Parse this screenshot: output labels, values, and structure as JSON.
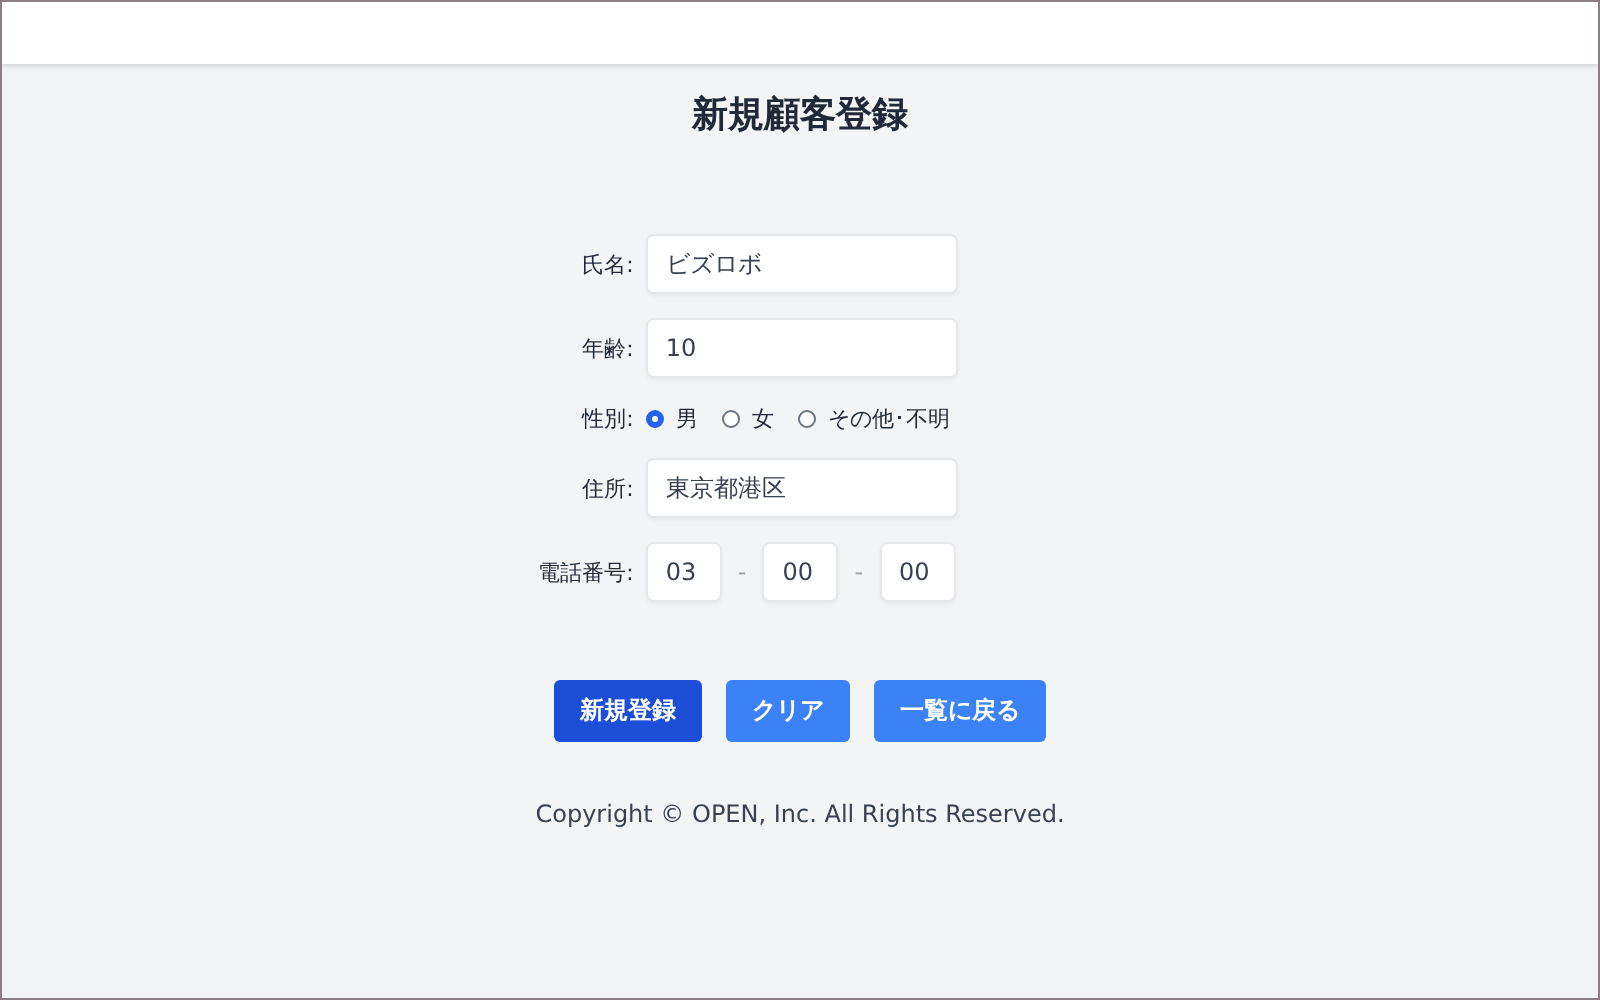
{
  "title": "新規顧客登録",
  "fields": [
    {
      "kind": "text",
      "label": "氏名:",
      "value": "ビズロボ"
    },
    {
      "kind": "text",
      "label": "年齢:",
      "value": "10"
    },
    {
      "kind": "radio",
      "label": "性別:",
      "options": [
        {
          "label": "男",
          "selected": true
        },
        {
          "label": "女",
          "selected": false
        },
        {
          "label": "その他･不明",
          "selected": false
        }
      ]
    },
    {
      "kind": "text",
      "label": "住所:",
      "value": "東京都港区"
    },
    {
      "kind": "phone",
      "label": "電話番号:",
      "parts": [
        "03",
        "00",
        "00"
      ],
      "separators": [
        "-",
        "-"
      ]
    }
  ],
  "buttons": [
    {
      "label": "新規登録",
      "kind": "primary"
    },
    {
      "label": "クリア",
      "kind": "secondary"
    },
    {
      "label": "一覧に戻る",
      "kind": "secondary"
    }
  ],
  "footer": "Copyright © OPEN, Inc. All Rights Reserved."
}
